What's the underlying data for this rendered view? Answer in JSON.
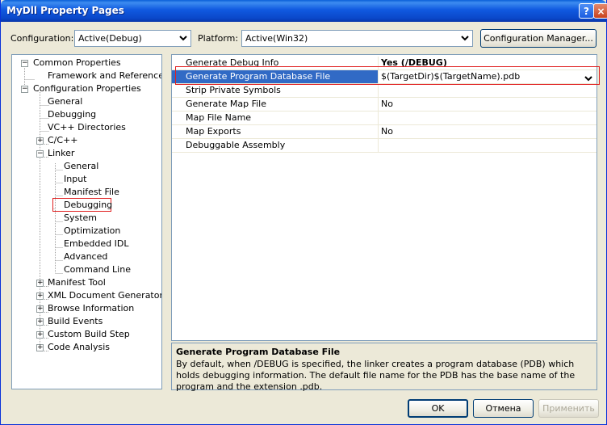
{
  "window": {
    "title": "MyDll Property Pages",
    "help": "?",
    "close": "×"
  },
  "toolbar": {
    "configuration_label": "Configuration:",
    "configuration_value": "Active(Debug)",
    "platform_label": "Platform:",
    "platform_value": "Active(Win32)",
    "config_manager": "Configuration Manager..."
  },
  "tree": {
    "items": [
      {
        "label": "Common Properties",
        "expander": "−"
      },
      {
        "label": "Framework and References",
        "expander": ""
      },
      {
        "label": "Configuration Properties",
        "expander": "−"
      },
      {
        "label": "General",
        "expander": ""
      },
      {
        "label": "Debugging",
        "expander": ""
      },
      {
        "label": "VC++ Directories",
        "expander": ""
      },
      {
        "label": "C/C++",
        "expander": "+"
      },
      {
        "label": "Linker",
        "expander": "−"
      },
      {
        "label": "General",
        "expander": ""
      },
      {
        "label": "Input",
        "expander": ""
      },
      {
        "label": "Manifest File",
        "expander": ""
      },
      {
        "label": "Debugging",
        "expander": ""
      },
      {
        "label": "System",
        "expander": ""
      },
      {
        "label": "Optimization",
        "expander": ""
      },
      {
        "label": "Embedded IDL",
        "expander": ""
      },
      {
        "label": "Advanced",
        "expander": ""
      },
      {
        "label": "Command Line",
        "expander": ""
      },
      {
        "label": "Manifest Tool",
        "expander": "+"
      },
      {
        "label": "XML Document Generator",
        "expander": "+"
      },
      {
        "label": "Browse Information",
        "expander": "+"
      },
      {
        "label": "Build Events",
        "expander": "+"
      },
      {
        "label": "Custom Build Step",
        "expander": "+"
      },
      {
        "label": "Code Analysis",
        "expander": "+"
      }
    ]
  },
  "grid": {
    "rows": [
      {
        "name": "Generate Debug Info",
        "value": "Yes (/DEBUG)"
      },
      {
        "name": "Generate Program Database File",
        "value": "$(TargetDir)$(TargetName).pdb"
      },
      {
        "name": "Strip Private Symbols",
        "value": ""
      },
      {
        "name": "Generate Map File",
        "value": "No"
      },
      {
        "name": "Map File Name",
        "value": ""
      },
      {
        "name": "Map Exports",
        "value": "No"
      },
      {
        "name": "Debuggable Assembly",
        "value": ""
      }
    ]
  },
  "description": {
    "title": "Generate Program Database File",
    "text": "By default, when /DEBUG is specified, the linker creates a program database (PDB) which holds debugging information. The default file name for the PDB has the base name of the program and the extension .pdb."
  },
  "buttons": {
    "ok": "OK",
    "cancel": "Отмена",
    "apply": "Применить"
  },
  "colors": {
    "selection": "#316ac5",
    "highlight_box": "#e02020",
    "titlebar": "#0a47c8"
  },
  "icons": {
    "combo_arrow": "chevron-down-icon"
  }
}
